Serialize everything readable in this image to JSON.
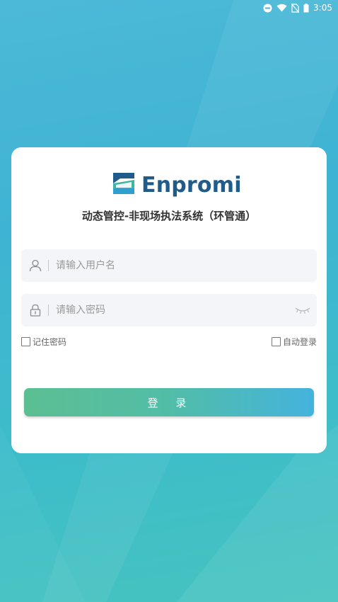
{
  "status_bar": {
    "time": "3:05",
    "icons": [
      "do-not-disturb-icon",
      "wifi-icon",
      "no-sim-icon",
      "battery-icon"
    ]
  },
  "logo": {
    "text": "Enpromi",
    "icon": "enpromi-logo-icon",
    "color": "#1f5c8c"
  },
  "app_title": "动态管控-非现场执法系统（环管通）",
  "username": {
    "placeholder": "请输入用户名",
    "value": "",
    "icon": "user-icon"
  },
  "password": {
    "placeholder": "请输入密码",
    "value": "",
    "icon": "lock-icon",
    "toggle_icon": "eye-closed-icon"
  },
  "remember_password": {
    "label": "记住密码",
    "checked": false
  },
  "auto_login": {
    "label": "自动登录",
    "checked": false
  },
  "login_button": {
    "label": "登 录"
  },
  "colors": {
    "background_start": "#4cb9d8",
    "background_end": "#46c3bf",
    "button_start": "#5cbf93",
    "button_end": "#44b3dd",
    "brand": "#1f5c8c"
  }
}
